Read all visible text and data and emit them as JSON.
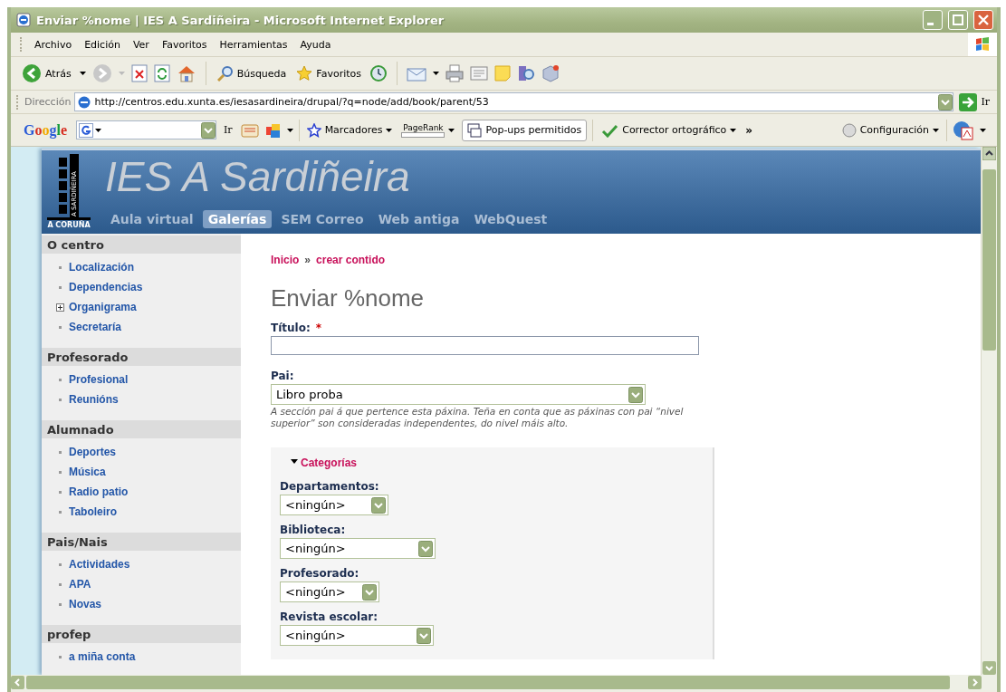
{
  "window": {
    "title": "Enviar %nome | IES A Sardiñeira - Microsoft Internet Explorer"
  },
  "menu": [
    {
      "label": "Archivo"
    },
    {
      "label": "Edición"
    },
    {
      "label": "Ver"
    },
    {
      "label": "Favoritos"
    },
    {
      "label": "Herramientas"
    },
    {
      "label": "Ayuda"
    }
  ],
  "toolbar": {
    "back": "Atrás",
    "forward_disabled": true,
    "search": "Búsqueda",
    "favorites": "Favoritos"
  },
  "address": {
    "label": "Dirección",
    "url": "http://centros.edu.xunta.es/iesasardineira/drupal/?q=node/add/book/parent/53",
    "go": "Ir"
  },
  "google_bar": {
    "logo": "Google",
    "go": "Ir",
    "bookmarks": "Marcadores",
    "pagerank": "PageRank",
    "popups": "Pop-ups permitidos",
    "spell": "Corrector ortográfico",
    "more": "»",
    "settings": "Configuración"
  },
  "site": {
    "name": "IES A Sardiñeira",
    "logo_text": "A SARDIÑEIRA",
    "logo_city": "A CORUÑA",
    "nav": [
      {
        "label": "Aula virtual",
        "selected": false
      },
      {
        "label": "Galerías",
        "selected": true
      },
      {
        "label": "SEM Correo",
        "selected": false
      },
      {
        "label": "Web antiga",
        "selected": false
      },
      {
        "label": "WebQuest",
        "selected": false
      }
    ]
  },
  "sidebar": [
    {
      "title": "O centro",
      "items": [
        {
          "label": "Localización",
          "kind": "leaf"
        },
        {
          "label": "Dependencias",
          "kind": "leaf"
        },
        {
          "label": "Organigrama",
          "kind": "expandable"
        },
        {
          "label": "Secretaría",
          "kind": "leaf"
        }
      ]
    },
    {
      "title": "Profesorado",
      "items": [
        {
          "label": "Profesional",
          "kind": "leaf"
        },
        {
          "label": "Reunións",
          "kind": "leaf"
        }
      ]
    },
    {
      "title": "Alumnado",
      "items": [
        {
          "label": "Deportes",
          "kind": "leaf"
        },
        {
          "label": "Música",
          "kind": "leaf"
        },
        {
          "label": "Radio patio",
          "kind": "leaf"
        },
        {
          "label": "Taboleiro",
          "kind": "leaf"
        }
      ]
    },
    {
      "title": "Pais/Nais",
      "items": [
        {
          "label": "Actividades",
          "kind": "leaf"
        },
        {
          "label": "APA",
          "kind": "leaf"
        },
        {
          "label": "Novas",
          "kind": "leaf"
        }
      ]
    },
    {
      "title": "profep",
      "items": [
        {
          "label": "a miña conta",
          "kind": "leaf"
        }
      ]
    }
  ],
  "breadcrumb": {
    "items": [
      "Inicio",
      "crear contido"
    ],
    "separator": "»"
  },
  "page_title": "Enviar %nome",
  "form": {
    "title_field": {
      "label": "Título:",
      "required_mark": "*"
    },
    "parent_field": {
      "label": "Pai:",
      "value": "Libro proba",
      "description": "A sección pai á que pertence esta páxina. Teña en conta que as páxinas con pai “nivel superior” son consideradas independentes, do nivel máis alto."
    },
    "categories": {
      "legend": "Categorías",
      "expanded": true,
      "fields": [
        {
          "label": "Departamentos:",
          "value": "<ningún>"
        },
        {
          "label": "Biblioteca:",
          "value": "<ningún>"
        },
        {
          "label": "Profesorado:",
          "value": "<ningún>"
        },
        {
          "label": "Revista escolar:",
          "value": "<ningún>"
        }
      ]
    }
  }
}
